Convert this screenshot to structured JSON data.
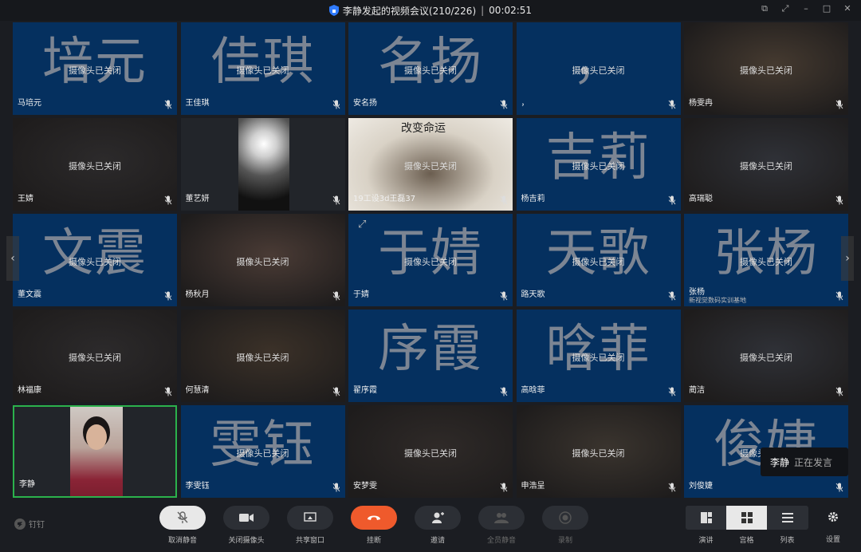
{
  "window": {
    "title": "李静发起的视频会议(210/226)",
    "timer": "00:02:51"
  },
  "tiles": [
    {
      "name": "马培元",
      "big": "培元",
      "status": "摄像头已关闭",
      "type": "avatar"
    },
    {
      "name": "王佳琪",
      "big": "佳琪",
      "status": "摄像头已关闭",
      "type": "avatar"
    },
    {
      "name": "安名扬",
      "big": "名扬",
      "status": "摄像头已关闭",
      "type": "avatar"
    },
    {
      "name": "，",
      "big": "，",
      "status": "摄像头已关闭",
      "type": "avatar"
    },
    {
      "name": "杨雯冉",
      "big": "",
      "status": "摄像头已关闭",
      "type": "photo"
    },
    {
      "name": "王婧",
      "big": "",
      "status": "摄像头已关闭",
      "type": "photo"
    },
    {
      "name": "董艺妍",
      "big": "",
      "status": "",
      "type": "video"
    },
    {
      "name": "19工设3d王磊37",
      "big": "",
      "status": "摄像头已关闭",
      "type": "photo",
      "caption": "改变命运"
    },
    {
      "name": "杨吉莉",
      "big": "吉莉",
      "status": "摄像头已关闭",
      "type": "avatar"
    },
    {
      "name": "高瑞聪",
      "big": "",
      "status": "摄像头已关闭",
      "type": "photo"
    },
    {
      "name": "董文震",
      "big": "文震",
      "status": "摄像头已关闭",
      "type": "avatar"
    },
    {
      "name": "杨秋月",
      "big": "",
      "status": "摄像头已关闭",
      "type": "photo"
    },
    {
      "name": "于婧",
      "big": "于婧",
      "status": "摄像头已关闭",
      "type": "avatar"
    },
    {
      "name": "路天歌",
      "big": "天歌",
      "status": "摄像头已关闭",
      "type": "avatar"
    },
    {
      "name": "张杨",
      "big": "张杨",
      "status": "摄像头已关闭",
      "type": "avatar",
      "sub": "新视觉数码实训基地"
    },
    {
      "name": "林福康",
      "big": "",
      "status": "摄像头已关闭",
      "type": "photo"
    },
    {
      "name": "何慧清",
      "big": "",
      "status": "摄像头已关闭",
      "type": "photo"
    },
    {
      "name": "翟序霞",
      "big": "序霞",
      "status": "",
      "type": "avatar"
    },
    {
      "name": "高晗菲",
      "big": "晗菲",
      "status": "摄像头已关闭",
      "type": "avatar"
    },
    {
      "name": "蔺洁",
      "big": "",
      "status": "摄像头已关闭",
      "type": "photo"
    },
    {
      "name": "李静",
      "big": "",
      "status": "",
      "type": "self"
    },
    {
      "name": "李雯钰",
      "big": "雯钰",
      "status": "摄像头已关闭",
      "type": "avatar"
    },
    {
      "name": "安梦雯",
      "big": "",
      "status": "摄像头已关闭",
      "type": "photo"
    },
    {
      "name": "申浩呈",
      "big": "",
      "status": "摄像头已关闭",
      "type": "photo"
    },
    {
      "name": "刘俊婕",
      "big": "俊婕",
      "status": "摄像头已关闭",
      "type": "avatar"
    }
  ],
  "speaking": {
    "name": "李静",
    "status": "正在发言"
  },
  "toolbar": {
    "brand": "钉钉",
    "unmute": "取消静音",
    "camera_off": "关闭摄像头",
    "share": "共享窗口",
    "hangup": "挂断",
    "invite": "邀请",
    "mute_all": "全员静音",
    "record": "录制",
    "layout_speaker": "演讲",
    "layout_grid": "宫格",
    "layout_list": "列表",
    "settings": "设置"
  },
  "colors": {
    "avatar_bg": "#05305f",
    "hangup": "#ef5a2c",
    "active_speaker_border": "#2bb24c"
  }
}
